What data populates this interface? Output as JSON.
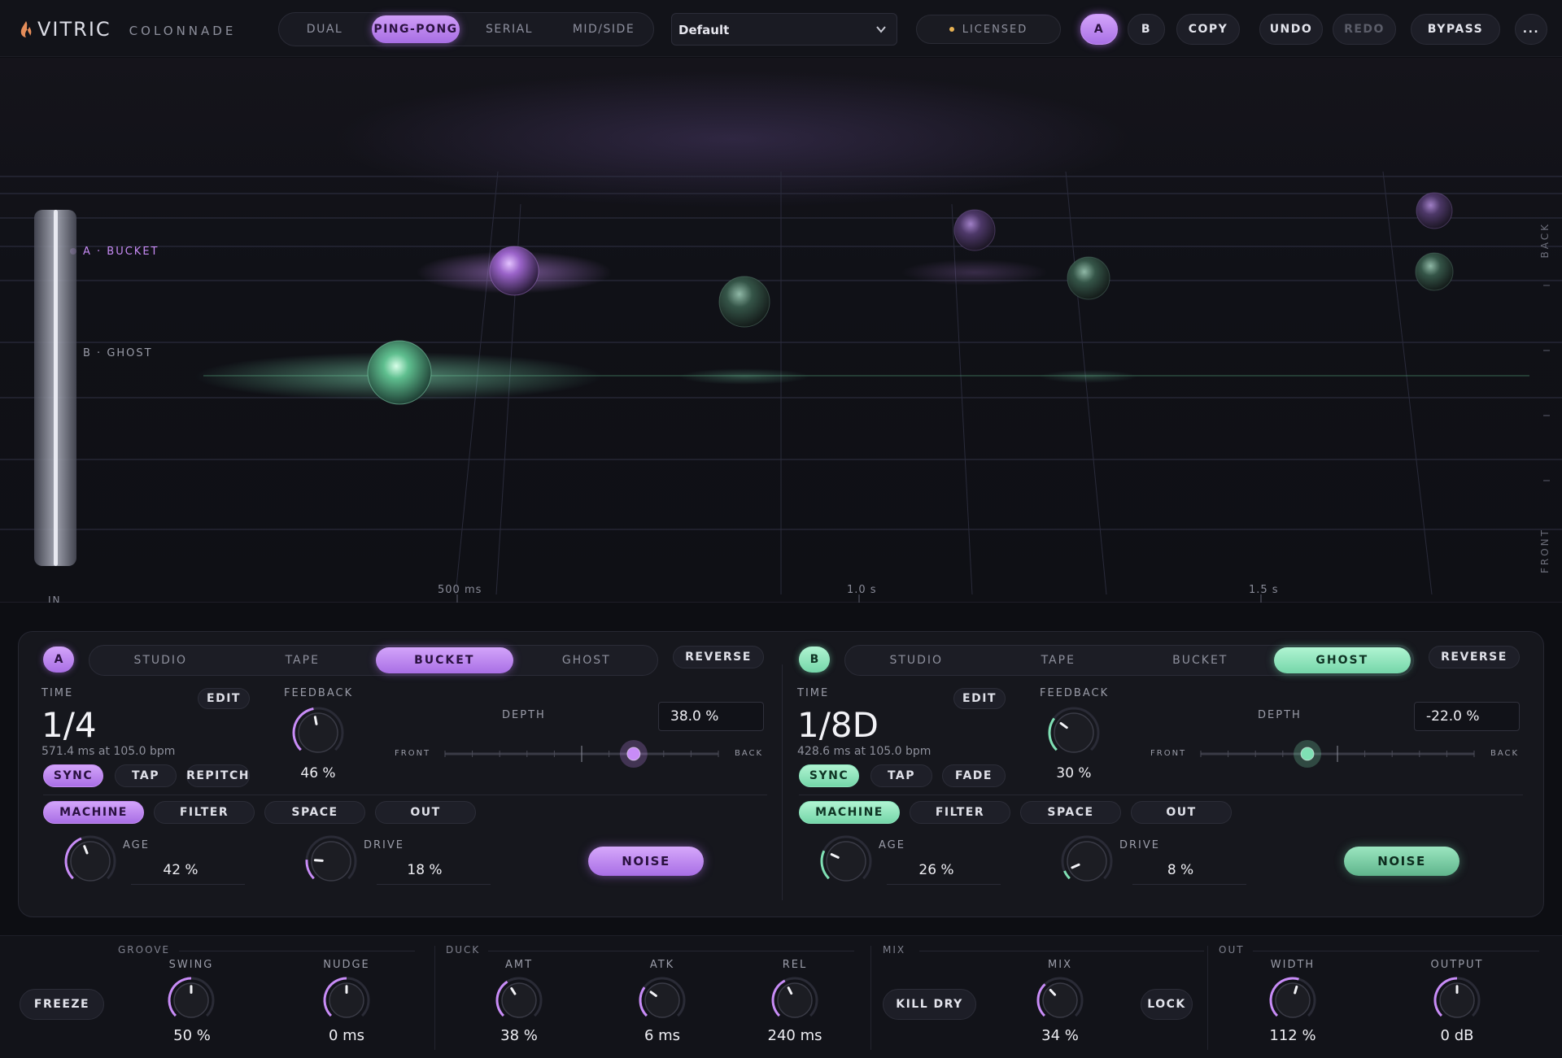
{
  "brand": {
    "name": "VITRIC",
    "product": "COLONNADE"
  },
  "routing": {
    "modes": [
      "DUAL",
      "PING-PONG",
      "SERIAL",
      "MID/SIDE"
    ],
    "active": "PING-PONG"
  },
  "preset": {
    "name": "Default"
  },
  "license": {
    "label": "LICENSED"
  },
  "toolbar": {
    "a_label": "A",
    "b_label": "B",
    "copy_label": "COPY",
    "undo_label": "UNDO",
    "redo_label": "REDO",
    "bypass_label": "BYPASS",
    "more_label": "..."
  },
  "visualizer": {
    "lane_a_label": "A · BUCKET",
    "lane_b_label": "B · GHOST",
    "ticks": [
      "500 ms",
      "1.0 s",
      "1.5 s"
    ],
    "side_back": "BACK",
    "side_front": "FRONT",
    "input_label": "IN"
  },
  "lane_a": {
    "badge": "A",
    "modes": [
      "STUDIO",
      "TAPE",
      "BUCKET",
      "GHOST"
    ],
    "active_mode": "BUCKET",
    "reverse_label": "REVERSE",
    "time_label": "TIME",
    "edit_label": "EDIT",
    "time_value": "1/4",
    "time_sub": "571.4 ms at 105.0 bpm",
    "sync_label": "SYNC",
    "tap_label": "TAP",
    "third_label": "REPITCH",
    "feedback_label": "FEEDBACK",
    "feedback_value": "46 %",
    "feedback_level": 0.46,
    "depth_label": "DEPTH",
    "depth_value": "38.0 %",
    "depth_level": 0.69,
    "front_label": "FRONT",
    "back_label": "BACK",
    "tabs": [
      "MACHINE",
      "FILTER",
      "SPACE",
      "OUT"
    ],
    "active_tab": "MACHINE",
    "age_label": "AGE",
    "age_value": "42 %",
    "age_level": 0.42,
    "drive_label": "DRIVE",
    "drive_value": "18 %",
    "drive_level": 0.18,
    "noise_label": "NOISE"
  },
  "lane_b": {
    "badge": "B",
    "modes": [
      "STUDIO",
      "TAPE",
      "BUCKET",
      "GHOST"
    ],
    "active_mode": "GHOST",
    "reverse_label": "REVERSE",
    "time_label": "TIME",
    "edit_label": "EDIT",
    "time_value": "1/8D",
    "time_sub": "428.6 ms at 105.0 bpm",
    "sync_label": "SYNC",
    "tap_label": "TAP",
    "third_label": "FADE",
    "feedback_label": "FEEDBACK",
    "feedback_value": "30 %",
    "feedback_level": 0.3,
    "depth_label": "DEPTH",
    "depth_value": "-22.0 %",
    "depth_level": 0.39,
    "front_label": "FRONT",
    "back_label": "BACK",
    "tabs": [
      "MACHINE",
      "FILTER",
      "SPACE",
      "OUT"
    ],
    "active_tab": "MACHINE",
    "age_label": "AGE",
    "age_value": "26 %",
    "age_level": 0.26,
    "drive_label": "DRIVE",
    "drive_value": "8 %",
    "drive_level": 0.08,
    "noise_label": "NOISE"
  },
  "bottom": {
    "freeze_label": "FREEZE",
    "groove": {
      "title": "GROOVE",
      "swing_label": "SWING",
      "swing_value": "50 %",
      "swing_level": 0.5,
      "nudge_label": "NUDGE",
      "nudge_value": "0 ms",
      "nudge_level": 0.5
    },
    "duck": {
      "title": "DUCK",
      "amt_label": "AMT",
      "amt_value": "38 %",
      "amt_level": 0.38,
      "atk_label": "ATK",
      "atk_value": "6 ms",
      "atk_level": 0.3,
      "rel_label": "REL",
      "rel_value": "240 ms",
      "rel_level": 0.4
    },
    "mix": {
      "title": "MIX",
      "kill_dry_label": "KILL DRY",
      "mix_label": "MIX",
      "mix_value": "34 %",
      "mix_level": 0.34,
      "lock_label": "LOCK"
    },
    "out": {
      "title": "OUT",
      "width_label": "WIDTH",
      "width_value": "112 %",
      "width_level": 0.56,
      "output_label": "OUTPUT",
      "output_value": "0 dB",
      "output_level": 0.5
    }
  },
  "colors": {
    "accent_a": "#c88cf7",
    "accent_b": "#7fe0b4",
    "licensed_dot": "#e8b253"
  }
}
